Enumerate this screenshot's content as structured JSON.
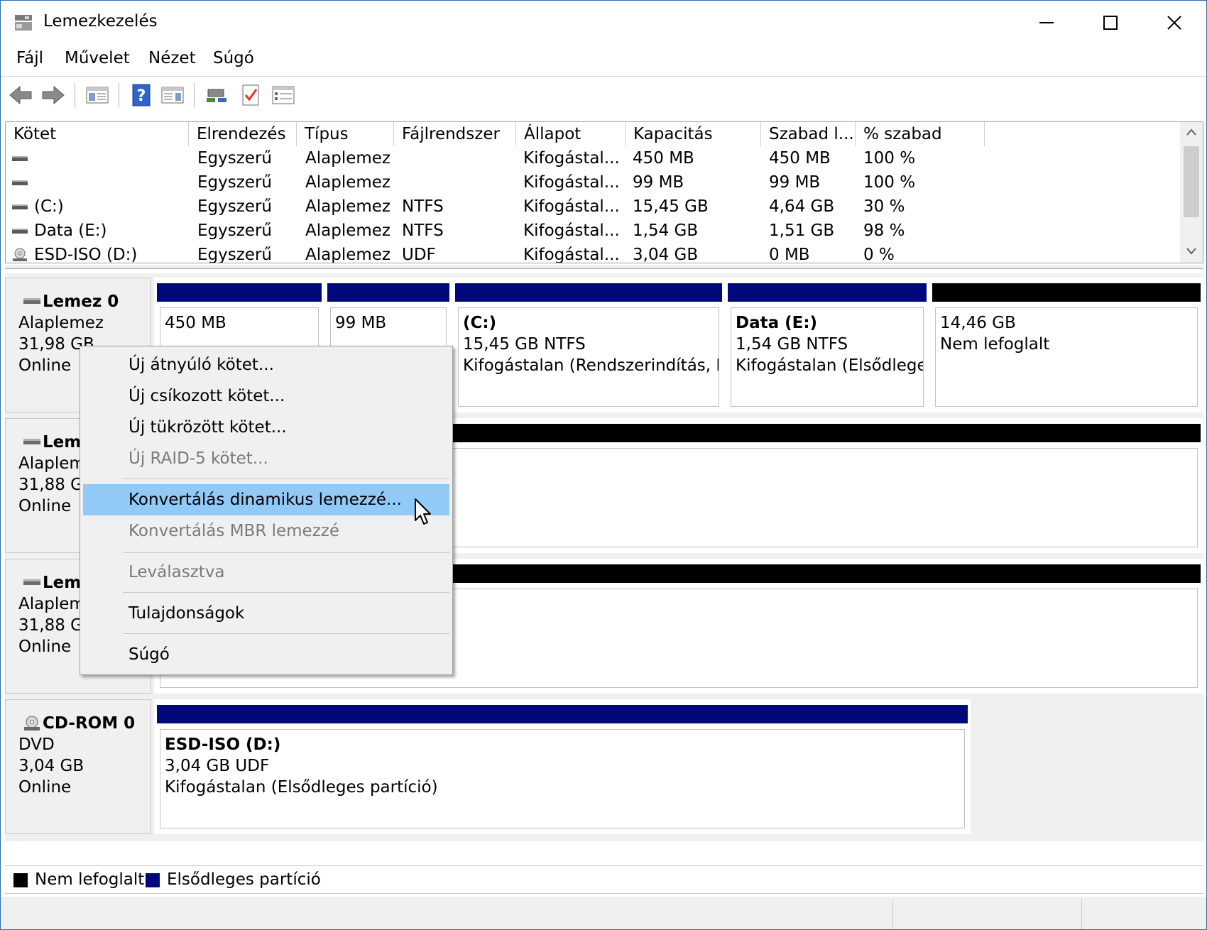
{
  "window": {
    "title": "Lemezkezelés",
    "controls": [
      "minimize",
      "maximize",
      "close"
    ]
  },
  "menu": {
    "file": "Fájl",
    "action": "Művelet",
    "view": "Nézet",
    "help": "Súgó"
  },
  "toolbar": {
    "icons": [
      "back-icon",
      "forward-icon",
      "show-hide-console-tree-icon",
      "help-icon",
      "show-hide-action-pane-icon",
      "connect-icon",
      "check-icon",
      "properties-icon"
    ]
  },
  "volume_list": {
    "columns": [
      "Kötet",
      "Elrendezés",
      "Típus",
      "Fájlrendszer",
      "Állapot",
      "Kapacitás",
      "Szabad l...",
      "% szabad"
    ],
    "rows": [
      {
        "volume": "",
        "layout": "Egyszerű",
        "type": "Alaplemez",
        "fs": "",
        "status": "Kifogástal...",
        "capacity": "450 MB",
        "free": "450 MB",
        "pct": "100 %",
        "icon": "drive-icon"
      },
      {
        "volume": "",
        "layout": "Egyszerű",
        "type": "Alaplemez",
        "fs": "",
        "status": "Kifogástal...",
        "capacity": "99 MB",
        "free": "99 MB",
        "pct": "100 %",
        "icon": "drive-icon"
      },
      {
        "volume": "(C:)",
        "layout": "Egyszerű",
        "type": "Alaplemez",
        "fs": "NTFS",
        "status": "Kifogástal...",
        "capacity": "15,45 GB",
        "free": "4,64 GB",
        "pct": "30 %",
        "icon": "drive-icon"
      },
      {
        "volume": "Data (E:)",
        "layout": "Egyszerű",
        "type": "Alaplemez",
        "fs": "NTFS",
        "status": "Kifogástal...",
        "capacity": "1,54 GB",
        "free": "1,51 GB",
        "pct": "98 %",
        "icon": "drive-icon"
      },
      {
        "volume": "ESD-ISO (D:)",
        "layout": "Egyszerű",
        "type": "Alaplemez",
        "fs": "UDF",
        "status": "Kifogástal...",
        "capacity": "3,04 GB",
        "free": "0 MB",
        "pct": "0 %",
        "icon": "cd-icon"
      }
    ]
  },
  "disks": [
    {
      "name": "Lemez 0",
      "type": "Alaplemez",
      "size": "31,98 GB",
      "state": "Online",
      "partitions": [
        {
          "line1": "",
          "line2": "450 MB",
          "line3": "",
          "kind": "primary"
        },
        {
          "line1": "",
          "line2": "99 MB",
          "line3": "",
          "kind": "primary"
        },
        {
          "line1": "(C:)",
          "line2": "15,45 GB NTFS",
          "line3": "Kifogástalan (Rendszerindítás, Lap",
          "kind": "primary"
        },
        {
          "line1": "Data  (E:)",
          "line2": "1,54 GB NTFS",
          "line3": "Kifogástalan (Elsődleges",
          "kind": "primary"
        },
        {
          "line1": "",
          "line2": "14,46 GB",
          "line3": "Nem lefoglalt",
          "kind": "unallocated"
        }
      ]
    },
    {
      "name": "Lemez 1",
      "type": "Alaplemez",
      "size": "31,88 GB",
      "state": "Online"
    },
    {
      "name": "Lemez 2",
      "type": "Alaplemez",
      "size": "31,88 GB",
      "state": "Online"
    },
    {
      "name": "CD-ROM 0",
      "type": "DVD",
      "size": "3,04 GB",
      "state": "Online",
      "partitions": [
        {
          "line1": "ESD-ISO  (D:)",
          "line2": "3,04 GB UDF",
          "line3": "Kifogástalan (Elsődleges partíció)",
          "kind": "primary"
        }
      ]
    }
  ],
  "legend": {
    "unallocated": "Nem lefoglalt",
    "primary": "Elsődleges partíció",
    "colors": {
      "unallocated": "#000000",
      "primary": "#00087a"
    }
  },
  "context_menu": {
    "items": [
      {
        "label": "Új átnyúló kötet...",
        "enabled": true
      },
      {
        "label": "Új csíkozott kötet...",
        "enabled": true
      },
      {
        "label": "Új tükrözött kötet...",
        "enabled": true
      },
      {
        "label": "Új RAID-5 kötet...",
        "enabled": false
      },
      {
        "label": "Konvertálás dinamikus lemezzé...",
        "enabled": true,
        "highlighted": true
      },
      {
        "label": "Konvertálás MBR lemezzé",
        "enabled": false
      },
      {
        "label": "Leválasztva",
        "enabled": false
      },
      {
        "label": "Tulajdonságok",
        "enabled": true
      },
      {
        "label": "Súgó",
        "enabled": true
      }
    ]
  }
}
